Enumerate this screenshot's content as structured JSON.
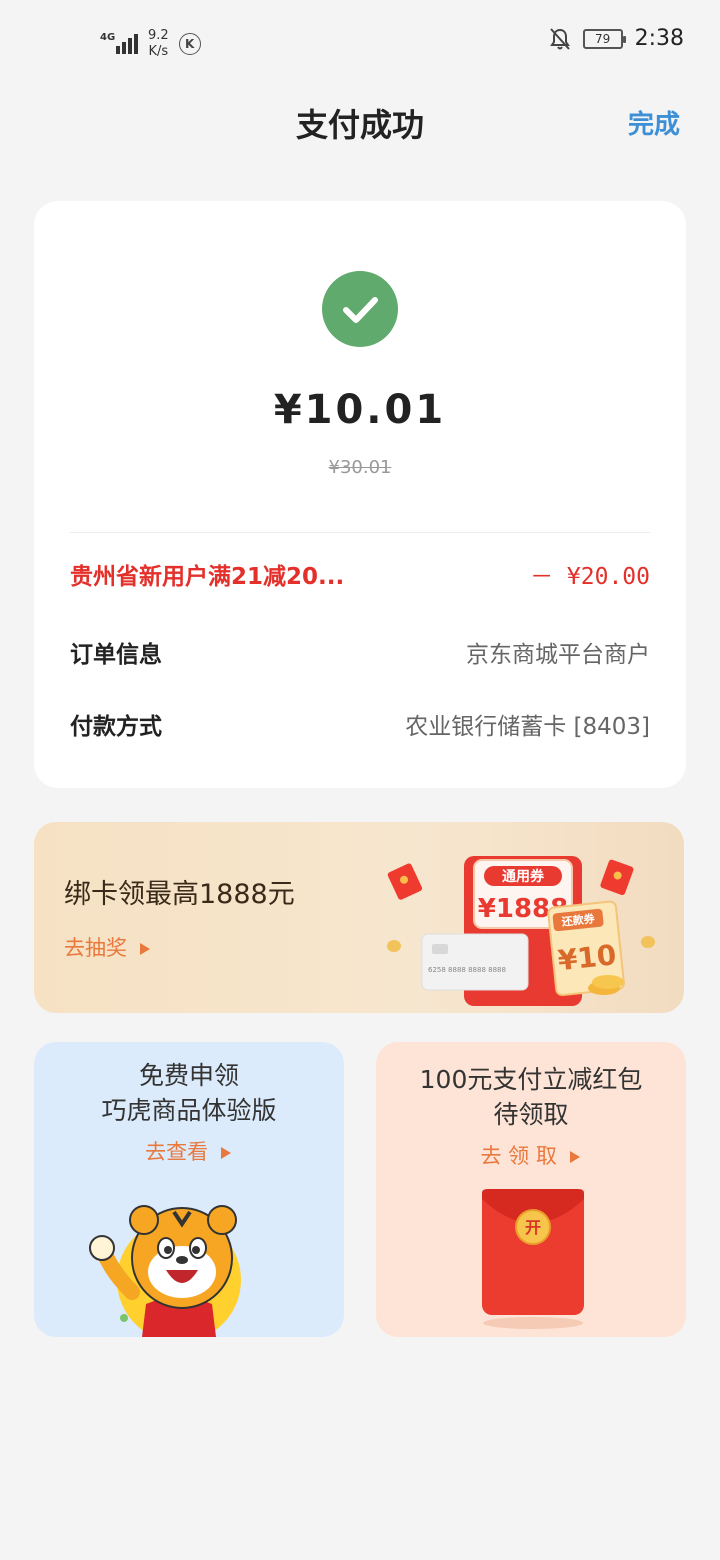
{
  "status_bar": {
    "network": "4G",
    "speed_value": "9.2",
    "speed_unit": "K/s",
    "k_badge": "K",
    "battery": "79",
    "time": "2:38",
    "icons": [
      "signal-icon",
      "k-badge-icon",
      "bell-mute-icon",
      "battery-icon"
    ]
  },
  "nav": {
    "title": "支付成功",
    "done_label": "完成"
  },
  "payment": {
    "amount": "¥10.01",
    "original_amount": "¥30.01",
    "status_icon": "check-circle-icon",
    "promo_label": "贵州省新用户满21减20...",
    "promo_value": "－ ¥20.00",
    "rows": [
      {
        "label": "订单信息",
        "value": "京东商城平台商户"
      },
      {
        "label": "付款方式",
        "value": "农业银行储蓄卡 [8403]"
      }
    ]
  },
  "bind_banner": {
    "title": "绑卡领最高1888元",
    "link": "去抽奖",
    "coupon_general_label": "通用券",
    "coupon_general_value": "¥1888",
    "coupon_repay_label": "还款券",
    "coupon_repay_value": "¥10",
    "card_number": "6258 8888 8888 8888"
  },
  "cards": [
    {
      "title_line1": "免费申领",
      "title_line2": "巧虎商品体验版",
      "link": "去查看"
    },
    {
      "title_line1": "100元支付立减红包",
      "title_line2": "待领取",
      "link": "去 领 取",
      "envelope_label": "开"
    }
  ],
  "colors": {
    "accent_blue": "#3d8fd6",
    "success_green": "#5faa6c",
    "promo_red": "#e4302b",
    "link_orange": "#e9783d"
  }
}
